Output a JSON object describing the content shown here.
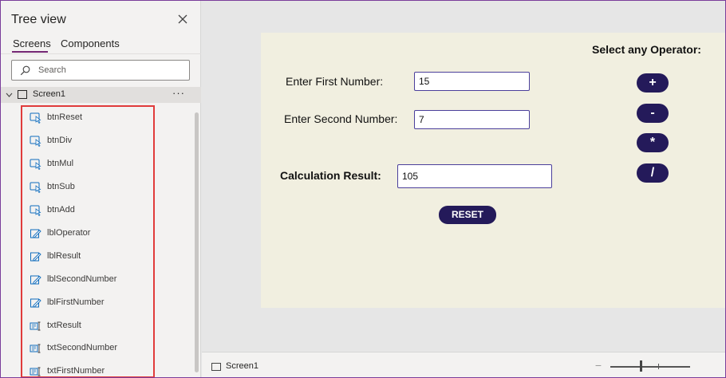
{
  "tree_view": {
    "title": "Tree view",
    "tabs": [
      {
        "label": "Screens",
        "active": true
      },
      {
        "label": "Components",
        "active": false
      }
    ],
    "search": {
      "placeholder": "Search",
      "value": ""
    },
    "screen": {
      "label": "Screen1",
      "more": "···"
    },
    "items": [
      {
        "label": "btnReset",
        "icon": "button-icon"
      },
      {
        "label": "btnDiv",
        "icon": "button-icon"
      },
      {
        "label": "btnMul",
        "icon": "button-icon"
      },
      {
        "label": "btnSub",
        "icon": "button-icon"
      },
      {
        "label": "btnAdd",
        "icon": "button-icon"
      },
      {
        "label": "lblOperator",
        "icon": "label-icon"
      },
      {
        "label": "lblResult",
        "icon": "label-icon"
      },
      {
        "label": "lblSecondNumber",
        "icon": "label-icon"
      },
      {
        "label": "lblFirstNumber",
        "icon": "label-icon"
      },
      {
        "label": "txtResult",
        "icon": "textinput-icon"
      },
      {
        "label": "txtSecondNumber",
        "icon": "textinput-icon"
      },
      {
        "label": "txtFirstNumber",
        "icon": "textinput-icon"
      }
    ]
  },
  "app": {
    "operator_title": "Select any Operator:",
    "first_label": "Enter First Number:",
    "first_value": "15",
    "second_label": "Enter Second Number:",
    "second_value": "7",
    "result_label": "Calculation Result:",
    "result_value": "105",
    "operators": [
      "+",
      "-",
      "*",
      "/"
    ],
    "reset_label": "RESET"
  },
  "statusbar": {
    "screen_label": "Screen1",
    "zoom_minus": "−"
  },
  "colors": {
    "accent": "#742774",
    "button_bg": "#241a5a",
    "screen_bg": "#f1efe0",
    "highlight_border": "#e03b3b"
  }
}
